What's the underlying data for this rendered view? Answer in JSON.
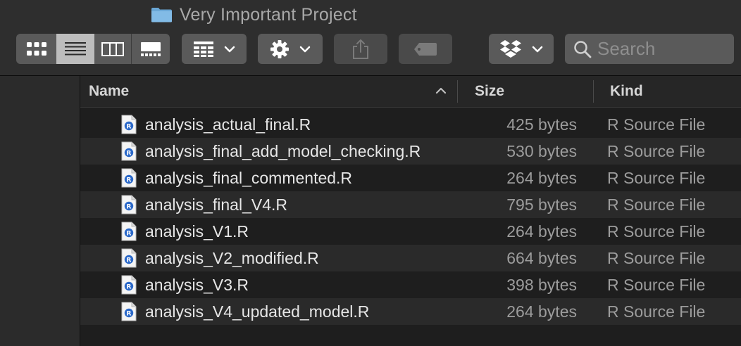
{
  "window": {
    "title": "Very Important Project",
    "title_icon": "folder-icon"
  },
  "toolbar": {
    "view_modes": [
      {
        "icon": "icon-view-icon",
        "active": false
      },
      {
        "icon": "list-view-icon",
        "active": true
      },
      {
        "icon": "column-view-icon",
        "active": false
      },
      {
        "icon": "gallery-view-icon",
        "active": false
      }
    ],
    "group_icon": "group-grid-icon",
    "action_icon": "gear-icon",
    "share_icon": "share-icon",
    "tag_icon": "tag-icon",
    "dropbox_icon": "dropbox-icon",
    "search_placeholder": "Search"
  },
  "columns": {
    "name": "Name",
    "size": "Size",
    "kind": "Kind",
    "sort": "ascending"
  },
  "files": [
    {
      "name": "analysis_actual_final.R",
      "size": "425 bytes",
      "kind": "R Source File"
    },
    {
      "name": "analysis_final_add_model_checking.R",
      "size": "530 bytes",
      "kind": "R Source File"
    },
    {
      "name": "analysis_final_commented.R",
      "size": "264 bytes",
      "kind": "R Source File"
    },
    {
      "name": "analysis_final_V4.R",
      "size": "795 bytes",
      "kind": "R Source File"
    },
    {
      "name": "analysis_V1.R",
      "size": "264 bytes",
      "kind": "R Source File"
    },
    {
      "name": "analysis_V2_modified.R",
      "size": "664 bytes",
      "kind": "R Source File"
    },
    {
      "name": "analysis_V3.R",
      "size": "398 bytes",
      "kind": "R Source File"
    },
    {
      "name": "analysis_V4_updated_model.R",
      "size": "264 bytes",
      "kind": "R Source File"
    }
  ],
  "colors": {
    "background": "#1e1e1e",
    "toolbar": "#2e2e2e",
    "button": "#5a5a5a",
    "active_button": "#bdbdbd",
    "r_icon_blue": "#2a68c9"
  }
}
